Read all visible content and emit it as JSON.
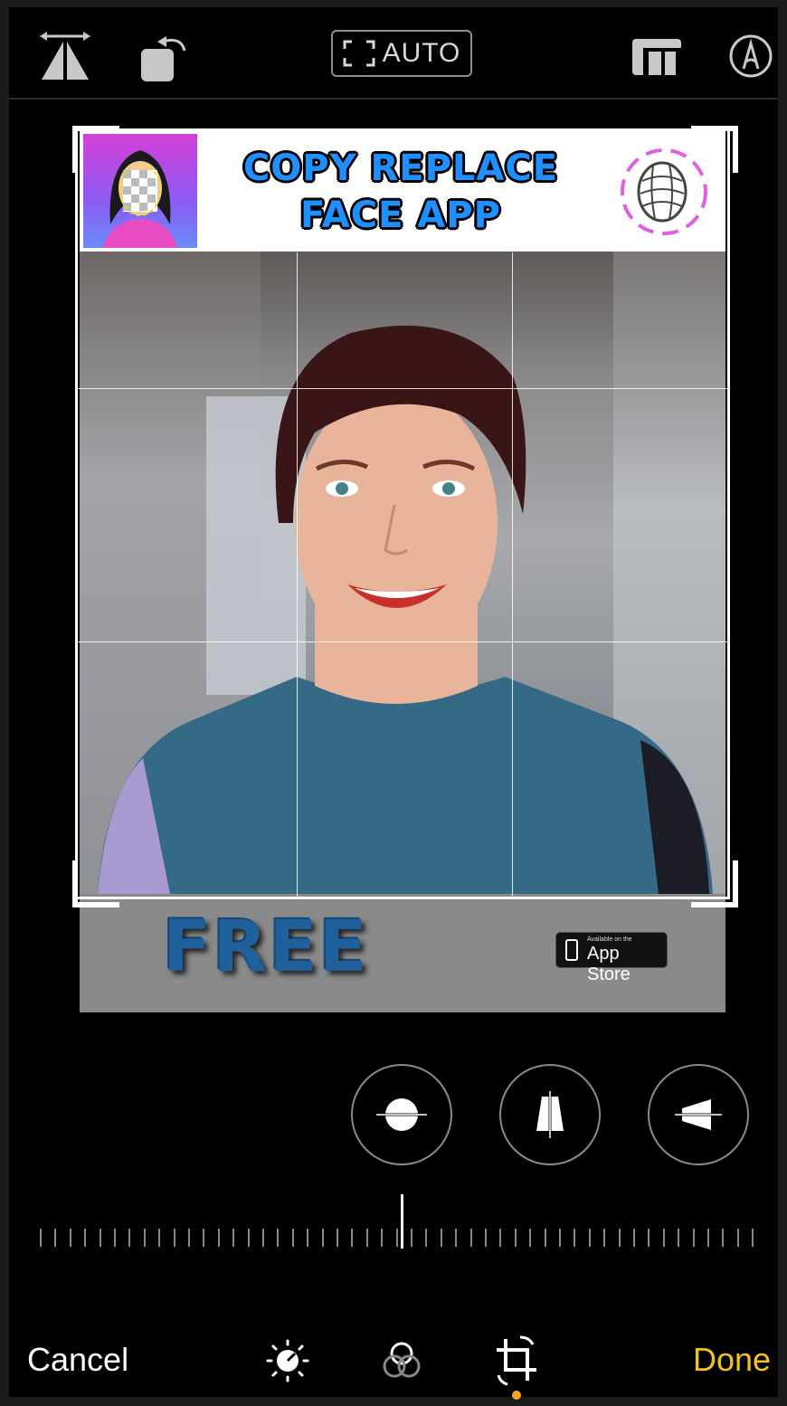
{
  "toolbar": {
    "flip_icon": "flip-horizontal-icon",
    "rotate_icon": "rotate-icon",
    "auto_label": "AUTO",
    "aspect_icon": "aspect-ratio-icon",
    "markup_icon": "markup-pen-icon"
  },
  "photo": {
    "banner_title_line1": "COPY REPLACE",
    "banner_title_line2": "FACE APP",
    "banner_free": "FREE",
    "appstore_small": "Available on the",
    "appstore_big": "App Store"
  },
  "adjust_buttons": [
    {
      "name": "straighten",
      "icon": "straighten-icon"
    },
    {
      "name": "vertical",
      "icon": "vertical-perspective-icon"
    },
    {
      "name": "horizontal",
      "icon": "horizontal-perspective-icon"
    }
  ],
  "bottom_bar": {
    "cancel_label": "Cancel",
    "done_label": "Done",
    "tools": [
      "adjust-icon",
      "filters-icon",
      "crop-icon"
    ],
    "active_tool": "crop-icon"
  },
  "colors": {
    "accent": "#f4c21b",
    "active_dot": "#f4a622",
    "background": "#000000"
  }
}
